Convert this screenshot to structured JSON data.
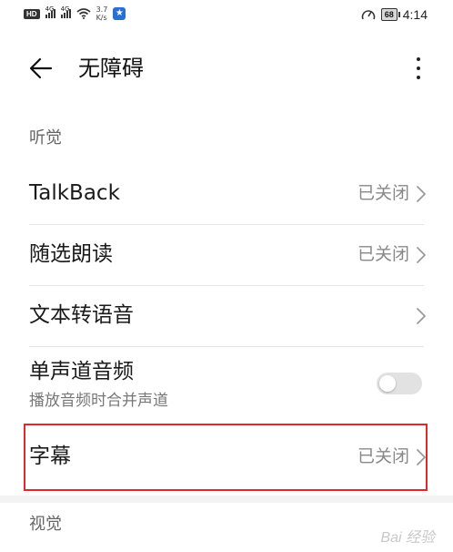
{
  "status_bar": {
    "hd_badge": "HD",
    "signal1_label": "4G",
    "signal2_label": "4G",
    "net_speed_value": "3.7",
    "net_speed_unit": "K/s",
    "battery": "68",
    "time": "4:14"
  },
  "app_bar": {
    "title": "无障碍"
  },
  "sections": {
    "hearing": "听觉",
    "vision": "视觉"
  },
  "items": {
    "talkback": {
      "title": "TalkBack",
      "status": "已关闭"
    },
    "select_to_speak": {
      "title": "随选朗读",
      "status": "已关闭"
    },
    "tts": {
      "title": "文本转语音"
    },
    "mono_audio": {
      "title": "单声道音频",
      "subtitle": "播放音频时合并声道",
      "enabled": false
    },
    "captions": {
      "title": "字幕",
      "status": "已关闭"
    }
  },
  "annotation": {
    "highlight_color": "#e02a2a"
  },
  "watermark": "Bai 经验"
}
